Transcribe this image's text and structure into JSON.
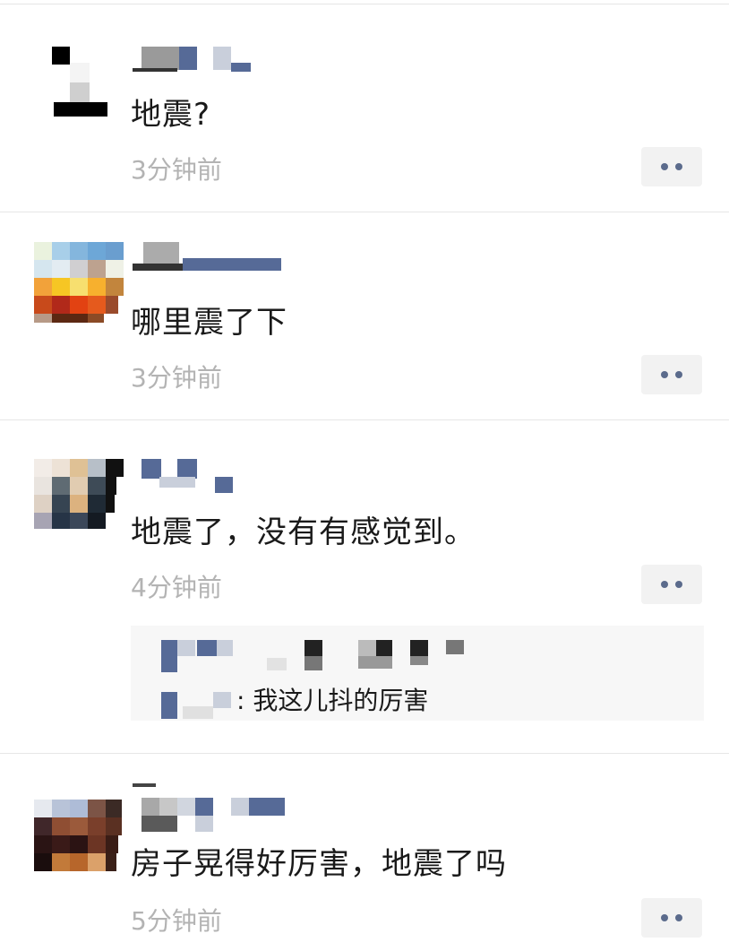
{
  "comments": [
    {
      "text": "地震?",
      "time": "3分钟前"
    },
    {
      "text": "哪里震了下",
      "time": "3分钟前"
    },
    {
      "text": "地震了，没有有感觉到。",
      "time": "4分钟前",
      "reply": {
        "text": ": 我这儿抖的厉害"
      }
    },
    {
      "text": "房子晃得好厉害，地震了吗",
      "time": "5分钟前"
    }
  ],
  "icons": {
    "more": "more-dots-icon"
  },
  "colors": {
    "link_blue": "#5b6b8c",
    "time_gray": "#b3b3b3",
    "button_bg": "#f2f2f2"
  }
}
